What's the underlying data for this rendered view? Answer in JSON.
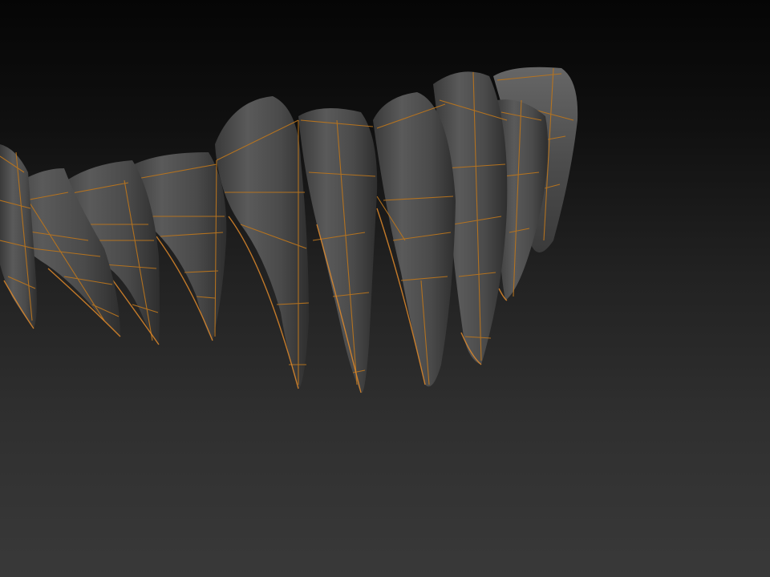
{
  "viewport": {
    "name": "3d-viewport",
    "model": "teeth-mesh",
    "wireframe_overlay": "polygroup-edges",
    "colors": {
      "background_top": "#050505",
      "background_bottom": "#393939",
      "mesh": "#4a4a4a",
      "wire": "#b8741e",
      "rim_light": "#e08a2a"
    }
  }
}
